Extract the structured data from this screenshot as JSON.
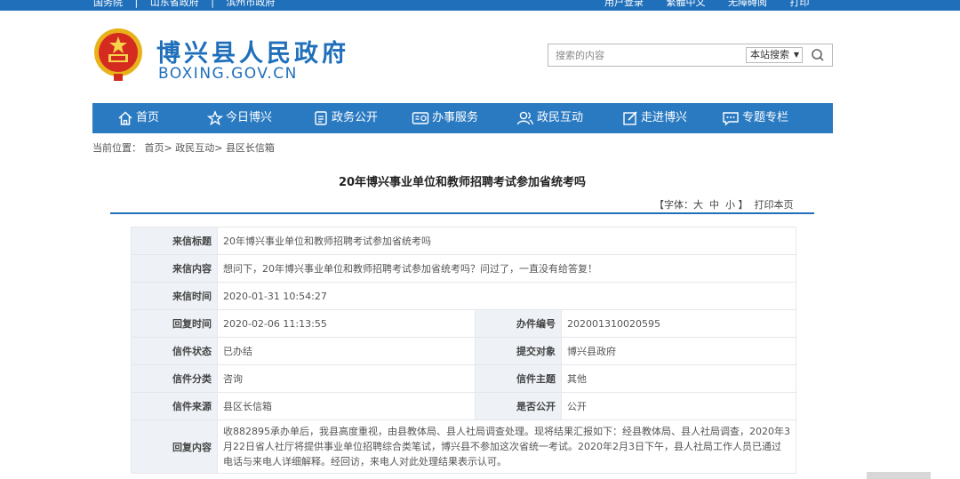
{
  "topbar": {
    "links_left": [
      "国务院",
      "山东省政府",
      "滨州市政府"
    ],
    "links_right": [
      "用户登录",
      "繁體中文",
      "无障碍阅",
      "打印"
    ]
  },
  "header": {
    "site_title": "博兴县人民政府",
    "site_domain": "BOXING.GOV.CN"
  },
  "search": {
    "placeholder": "搜索的内容",
    "scope": "本站搜索"
  },
  "nav": {
    "items": [
      {
        "label": "首页",
        "icon": "home-icon"
      },
      {
        "label": "今日博兴",
        "icon": "star-icon"
      },
      {
        "label": "政务公开",
        "icon": "document-icon"
      },
      {
        "label": "办事服务",
        "icon": "service-icon"
      },
      {
        "label": "政民互动",
        "icon": "people-icon"
      },
      {
        "label": "走进博兴",
        "icon": "edit-icon"
      },
      {
        "label": "专题专栏",
        "icon": "chat-icon"
      }
    ]
  },
  "breadcrumb": {
    "prefix": "当前位置：",
    "items": [
      "首页",
      "政民互动",
      "县区长信箱"
    ]
  },
  "article": {
    "title": "20年博兴事业单位和教师招聘考试参加省统考吗",
    "font_label": "【字体：",
    "font_large": "大",
    "font_medium": "中",
    "font_small": "小",
    "font_close": "】",
    "print": "打印本页"
  },
  "letter": {
    "subject_label": "来信标题",
    "subject": "20年博兴事业单位和教师招聘考试参加省统考吗",
    "content_label": "来信内容",
    "content": "想问下，20年博兴事业单位和教师招聘考试参加省统考吗？问过了，一直没有给答复！",
    "sent_label": "来信时间",
    "sent": "2020-01-31 10:54:27",
    "reply_time_label": "回复时间",
    "reply_time": "2020-02-06 11:13:55",
    "case_no_label": "办件编号",
    "case_no": "202001310020595",
    "status_label": "信件状态",
    "status": "已办结",
    "target_label": "提交对象",
    "target": "博兴县政府",
    "category_label": "信件分类",
    "category": "咨询",
    "topic_label": "信件主题",
    "topic": "其他",
    "source_label": "信件来源",
    "source": "县区长信箱",
    "public_label": "是否公开",
    "public": "公开",
    "reply_label": "回复内容",
    "reply": "收882895承办单后，我县高度重视，由县教体局、县人社局调查处理。现将结果汇报如下：经县教体局、县人社局调查，2020年3月22日省人社厅将提供事业单位招聘综合类笔试，博兴县不参加这次省统一考试。2020年2月3日下午，县人社局工作人员已通过电话与来电人详细解释。经回访，来电人对此处理结果表示认可。"
  },
  "colors": {
    "brand_blue": "#1f6fba",
    "nav_blue": "#2a7ac2",
    "label_bg": "#eef2f6"
  }
}
